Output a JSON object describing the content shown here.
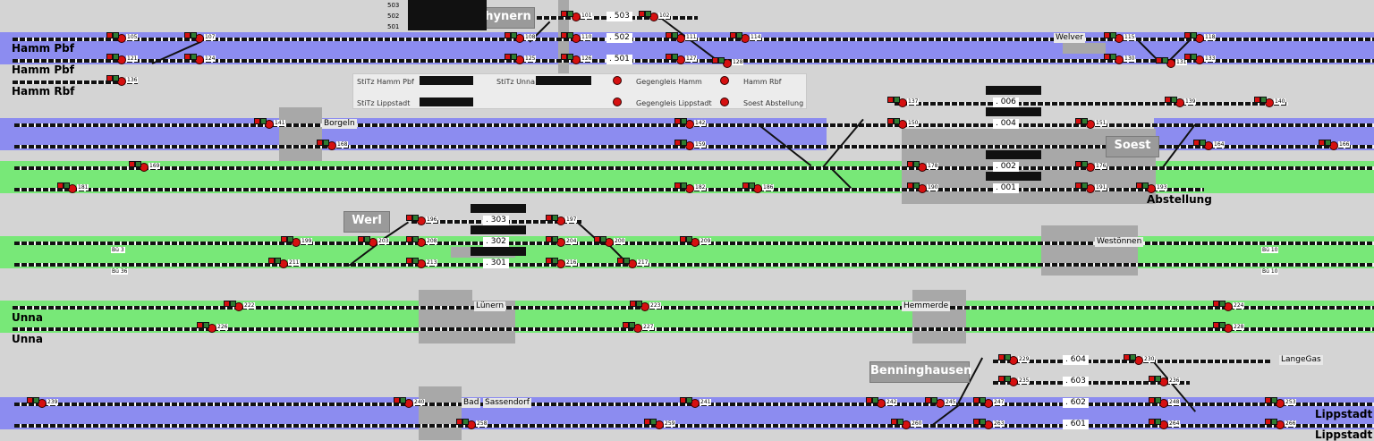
{
  "stations": {
    "hamm_pbf_1": "Hamm Pbf",
    "hamm_pbf_2": "Hamm Pbf",
    "hamm_rbf": "Hamm Rbf",
    "unna_1": "Unna",
    "unna_2": "Unna",
    "lippstadt_1": "Lippstadt",
    "lippstadt_2": "Lippstadt",
    "abstellung": "Abstellung",
    "rhynern": "Rhynern",
    "werl": "Werl",
    "soest": "Soest",
    "benninghausen": "Benninghausen"
  },
  "places": {
    "borgeln": "Borgeln",
    "welver": "Welver",
    "westonnen": "Westönnen",
    "lunern": "Lünern",
    "hemmerde": "Hemmerde",
    "bad": "Bad",
    "sassendorf": "Sassendorf",
    "lange_gas": "LangeGas"
  },
  "stitz": {
    "col1": [
      "503",
      "502",
      "501"
    ]
  },
  "track_numbers": {
    "t503": ". 503",
    "t502": ". 502",
    "t501": ". 501",
    "t006": ". 006",
    "t004": ". 004",
    "t002": ". 002",
    "t001": ". 001",
    "t303": ". 303",
    "t302": ". 302",
    "t301": ". 301",
    "t604": ". 604",
    "t603": ". 603",
    "t602": ". 602",
    "t601": ". 601"
  },
  "legend": {
    "stitz_hamm": "StiTz Hamm Pbf",
    "stitz_unna": "StiTz Unna",
    "stitz_lippstadt": "StiTz Lippstadt",
    "gegengleis_hamm": "Gegengleis Hamm",
    "gegengleis_lippstadt": "Gegengleis Lippstadt",
    "hamm_rbf": "Hamm Rbf",
    "soest_abstellung": "Soest Abstellung"
  },
  "bue": {
    "b1": "Bü 3",
    "b2": "Bü 36",
    "b3": "Bü 10",
    "b4": "Bü 10"
  },
  "signals": [
    {
      "n": "105"
    },
    {
      "n": "107"
    },
    {
      "n": "121"
    },
    {
      "n": "124"
    },
    {
      "n": "136"
    },
    {
      "n": "101"
    },
    {
      "n": "102"
    },
    {
      "n": "108"
    },
    {
      "n": "110"
    },
    {
      "n": "111"
    },
    {
      "n": "114"
    },
    {
      "n": "125"
    },
    {
      "n": "126"
    },
    {
      "n": "127"
    },
    {
      "n": "128"
    },
    {
      "n": "115"
    },
    {
      "n": "118"
    },
    {
      "n": "130"
    },
    {
      "n": "131"
    },
    {
      "n": "133"
    },
    {
      "n": "137"
    },
    {
      "n": "139"
    },
    {
      "n": "140"
    },
    {
      "n": "141"
    },
    {
      "n": "142"
    },
    {
      "n": "150"
    },
    {
      "n": "151"
    },
    {
      "n": "159"
    },
    {
      "n": "164"
    },
    {
      "n": "166"
    },
    {
      "n": "168"
    },
    {
      "n": "169"
    },
    {
      "n": "176"
    },
    {
      "n": "178"
    },
    {
      "n": "181"
    },
    {
      "n": "182"
    },
    {
      "n": "186"
    },
    {
      "n": "190"
    },
    {
      "n": "191"
    },
    {
      "n": "193"
    },
    {
      "n": "196"
    },
    {
      "n": "197"
    },
    {
      "n": "199"
    },
    {
      "n": "200"
    },
    {
      "n": "203"
    },
    {
      "n": "204"
    },
    {
      "n": "208"
    },
    {
      "n": "209"
    },
    {
      "n": "211"
    },
    {
      "n": "213"
    },
    {
      "n": "216"
    },
    {
      "n": "217"
    },
    {
      "n": "222"
    },
    {
      "n": "223"
    },
    {
      "n": "224"
    },
    {
      "n": "226"
    },
    {
      "n": "227"
    },
    {
      "n": "228"
    },
    {
      "n": "229"
    },
    {
      "n": "230"
    },
    {
      "n": "235"
    },
    {
      "n": "236"
    },
    {
      "n": "239"
    },
    {
      "n": "240"
    },
    {
      "n": "241"
    },
    {
      "n": "242"
    },
    {
      "n": "245"
    },
    {
      "n": "247"
    },
    {
      "n": "248"
    },
    {
      "n": "253"
    },
    {
      "n": "258"
    },
    {
      "n": "259"
    },
    {
      "n": "260"
    },
    {
      "n": "263"
    },
    {
      "n": "264"
    },
    {
      "n": "266"
    }
  ]
}
